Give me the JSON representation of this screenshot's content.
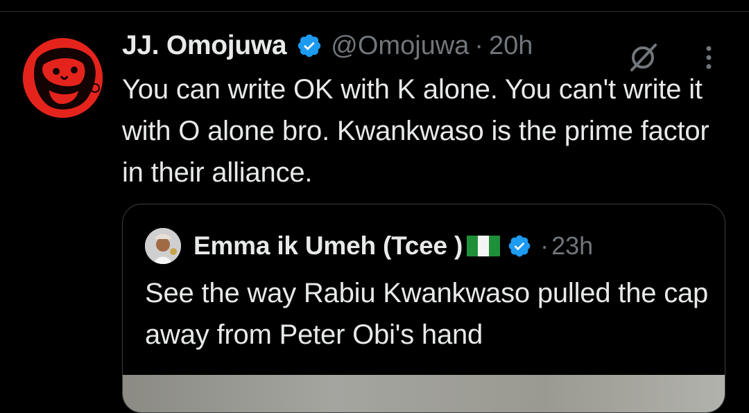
{
  "tweet": {
    "display_name": "JJ. Omojuwa",
    "handle": "@Omojuwa",
    "separator": "·",
    "time": "20h",
    "text": "You can write OK with K alone. You can't write it with O alone bro. Kwankwaso is the prime factor in their alliance.",
    "avatar_icon": "profile-avatar",
    "verified_icon": "verified-badge-icon",
    "grok_icon": "grok-icon",
    "more_icon": "more-options-icon"
  },
  "quote": {
    "display_name": "Emma ik Umeh (Tcee )",
    "flag": "nigeria-flag-icon",
    "separator": "·",
    "time": "23h",
    "text": "See the way Rabiu Kwankwaso pulled the cap away from Peter Obi's hand",
    "avatar_icon": "profile-avatar"
  },
  "colors": {
    "background": "#000000",
    "text_primary": "#e7e9ea",
    "text_secondary": "#71767b",
    "verified": "#1d9bf0",
    "avatar_red": "#e4241c",
    "border": "#3a3f44"
  }
}
